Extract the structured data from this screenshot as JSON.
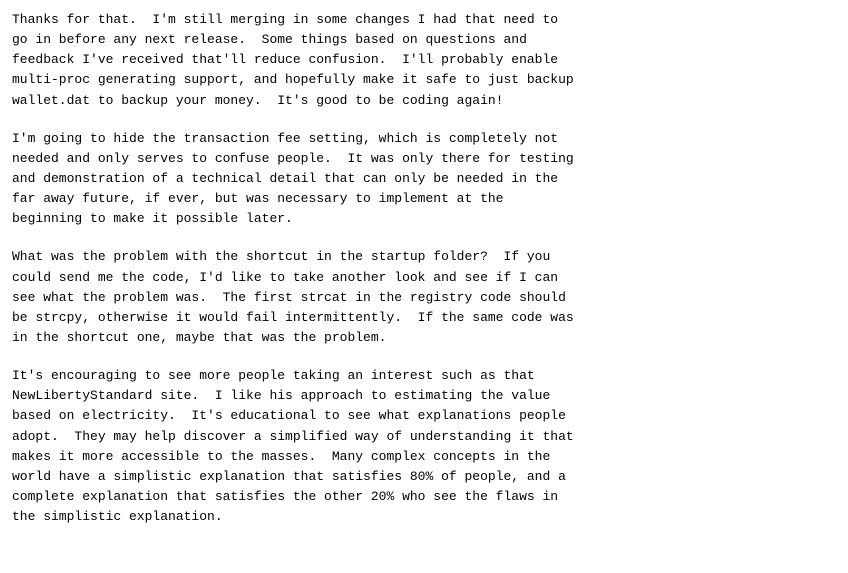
{
  "paragraphs": [
    {
      "id": "para1",
      "text": "Thanks for that.  I'm still merging in some changes I had that need to\ngo in before any next release.  Some things based on questions and\nfeedback I've received that'll reduce confusion.  I'll probably enable\nmulti-proc generating support, and hopefully make it safe to just backup\nwallet.dat to backup your money.  It's good to be coding again!"
    },
    {
      "id": "para2",
      "text": "I'm going to hide the transaction fee setting, which is completely not\nneeded and only serves to confuse people.  It was only there for testing\nand demonstration of a technical detail that can only be needed in the\nfar away future, if ever, but was necessary to implement at the\nbeginning to make it possible later."
    },
    {
      "id": "para3",
      "text": "What was the problem with the shortcut in the startup folder?  If you\ncould send me the code, I'd like to take another look and see if I can\nsee what the problem was.  The first strcat in the registry code should\nbe strcpy, otherwise it would fail intermittently.  If the same code was\nin the shortcut one, maybe that was the problem."
    },
    {
      "id": "para4",
      "text": "It's encouraging to see more people taking an interest such as that\nNewLibertyStandard site.  I like his approach to estimating the value\nbased on electricity.  It's educational to see what explanations people\nadopt.  They may help discover a simplified way of understanding it that\nmakes it more accessible to the masses.  Many complex concepts in the\nworld have a simplistic explanation that satisfies 80% of people, and a\ncomplete explanation that satisfies the other 20% who see the flaws in\nthe simplistic explanation."
    }
  ]
}
